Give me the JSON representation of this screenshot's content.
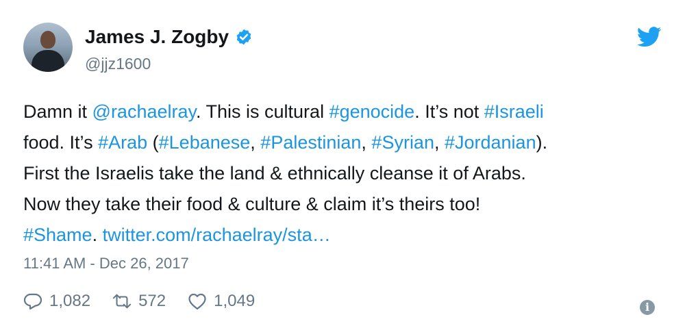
{
  "author": {
    "name": "James J. Zogby",
    "handle": "@jjz1600",
    "verified": true
  },
  "tweet": {
    "lines": [
      [
        {
          "text": "Damn it ",
          "type": "text"
        },
        {
          "text": "@rachaelray",
          "type": "mention"
        },
        {
          "text": ". This is cultural ",
          "type": "text"
        },
        {
          "text": "#genocide",
          "type": "hashtag"
        },
        {
          "text": ". It’s not ",
          "type": "text"
        },
        {
          "text": "#Israeli",
          "type": "hashtag"
        }
      ],
      [
        {
          "text": "food. It’s ",
          "type": "text"
        },
        {
          "text": "#Arab",
          "type": "hashtag"
        },
        {
          "text": " (",
          "type": "text"
        },
        {
          "text": "#Lebanese",
          "type": "hashtag"
        },
        {
          "text": ", ",
          "type": "text"
        },
        {
          "text": "#Palestinian",
          "type": "hashtag"
        },
        {
          "text": ", ",
          "type": "text"
        },
        {
          "text": "#Syrian",
          "type": "hashtag"
        },
        {
          "text": ", ",
          "type": "text"
        },
        {
          "text": "#Jordanian",
          "type": "hashtag"
        },
        {
          "text": ").",
          "type": "text"
        }
      ],
      [
        {
          "text": "First the Israelis take the land & ethnically cleanse it of Arabs.",
          "type": "text"
        }
      ],
      [
        {
          "text": "Now they take their food & culture & claim it’s theirs too!",
          "type": "text"
        }
      ],
      [
        {
          "text": "#Shame",
          "type": "hashtag"
        },
        {
          "text": ". ",
          "type": "text"
        },
        {
          "text": "twitter.com/rachaelray/sta…",
          "type": "url"
        }
      ]
    ],
    "timestamp": "11:41 AM - Dec 26, 2017"
  },
  "actions": {
    "replies": "1,082",
    "retweets": "572",
    "likes": "1,049"
  },
  "icons": {
    "brand": "twitter-bird-icon",
    "verified": "verified-badge-icon",
    "reply": "reply-icon",
    "retweet": "retweet-icon",
    "like": "heart-icon",
    "info": "info-icon"
  },
  "colors": {
    "link": "#1b95e0",
    "muted": "#657786",
    "text": "#14171a",
    "brand": "#1da1f2"
  }
}
